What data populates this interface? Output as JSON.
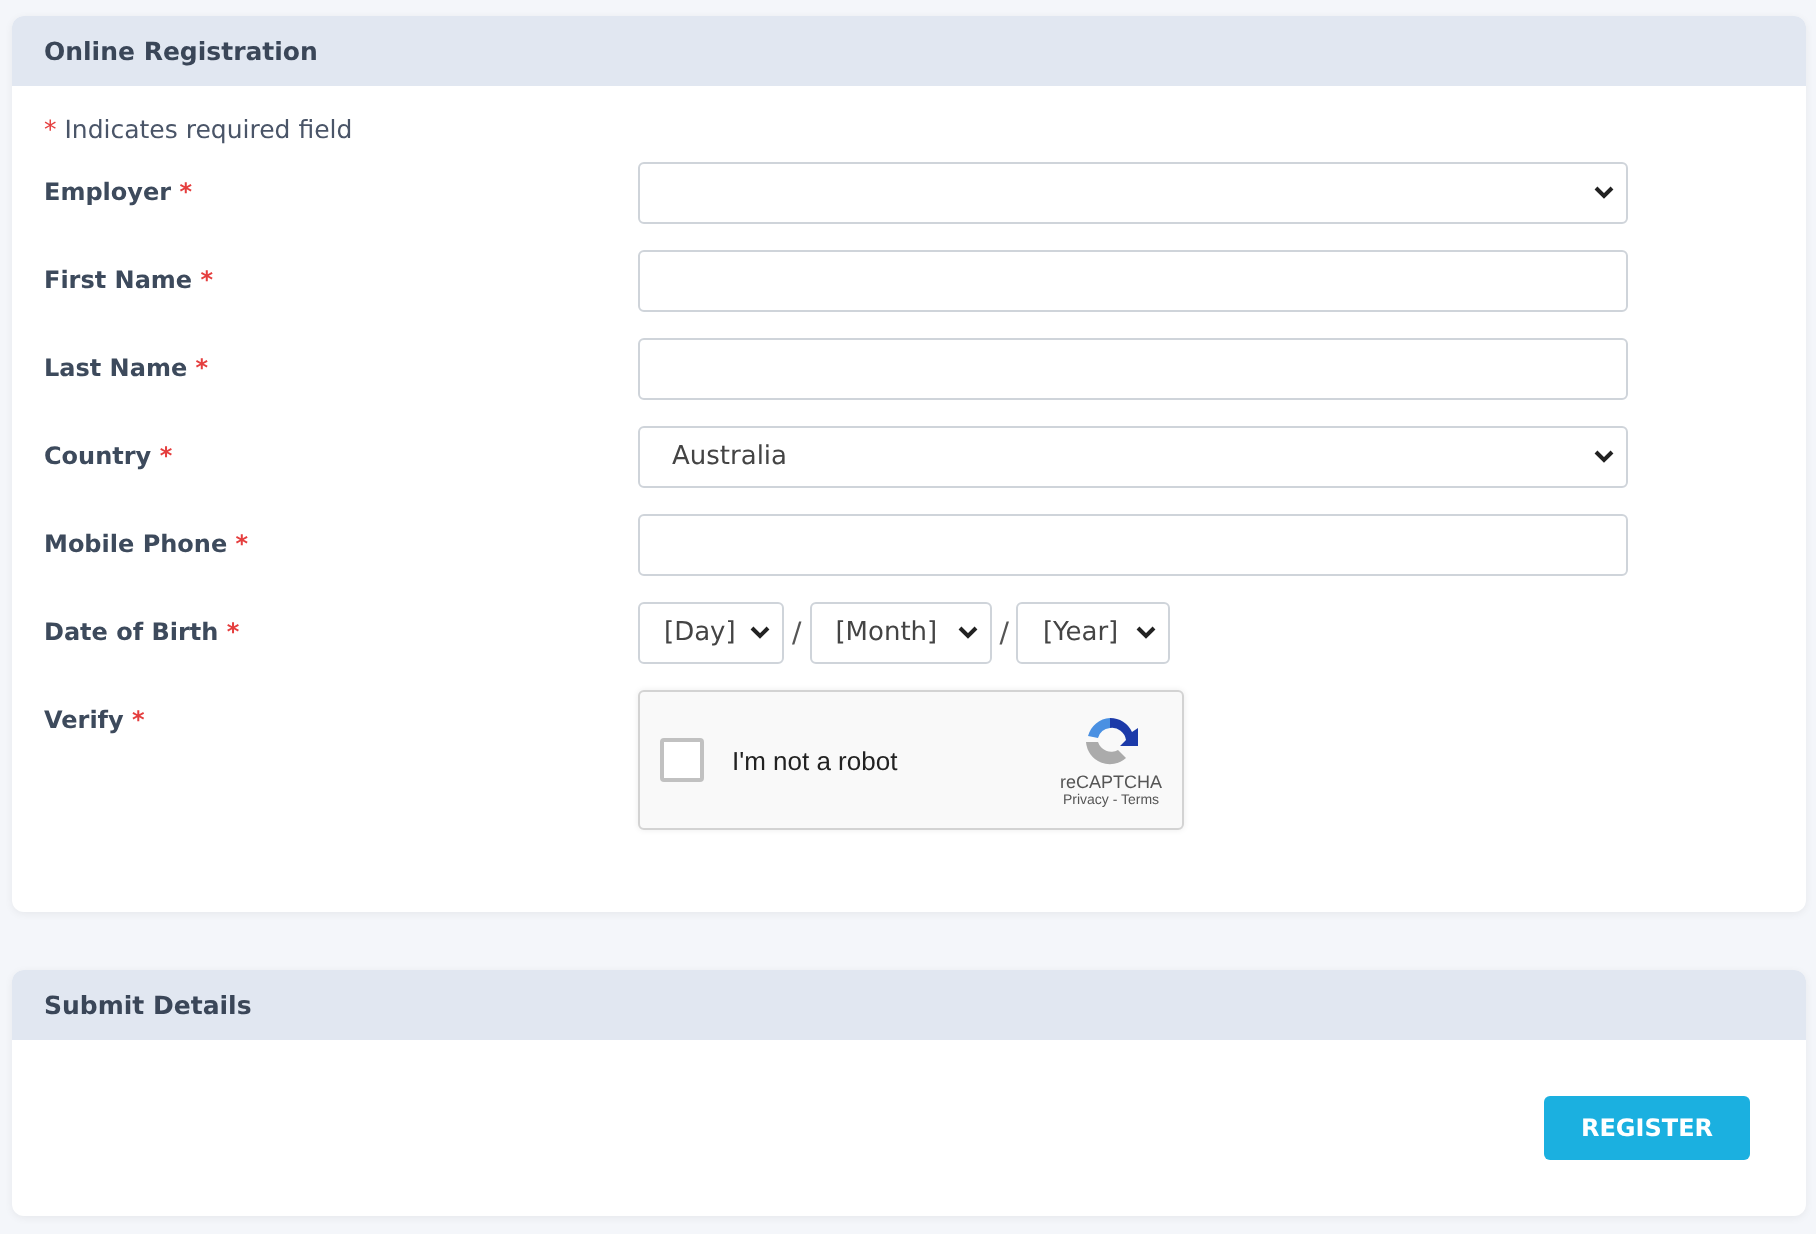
{
  "registration": {
    "title": "Online Registration",
    "required_note": {
      "mark": "*",
      "text": "Indicates required field"
    },
    "fields": [
      {
        "kind": "select",
        "label": "Employer",
        "mark": "*"
      },
      {
        "kind": "text",
        "label": "First Name",
        "mark": "*"
      },
      {
        "kind": "text",
        "label": "Last Name",
        "mark": "*"
      },
      {
        "kind": "select",
        "label": "Country",
        "mark": "*",
        "value": "Australia"
      },
      {
        "kind": "text",
        "label": "Mobile Phone",
        "mark": "*"
      },
      {
        "kind": "date",
        "label": "Date of Birth",
        "mark": "*",
        "parts": [
          "[Day]",
          "[Month]",
          "[Year]"
        ],
        "separator": "/"
      },
      {
        "kind": "captcha",
        "label": "Verify",
        "mark": "*",
        "captcha": {
          "checked": false,
          "text": "I'm not a robot",
          "brand": "reCAPTCHA",
          "links": "Privacy - Terms"
        }
      }
    ]
  },
  "submit": {
    "title": "Submit Details",
    "button": "REGISTER"
  }
}
